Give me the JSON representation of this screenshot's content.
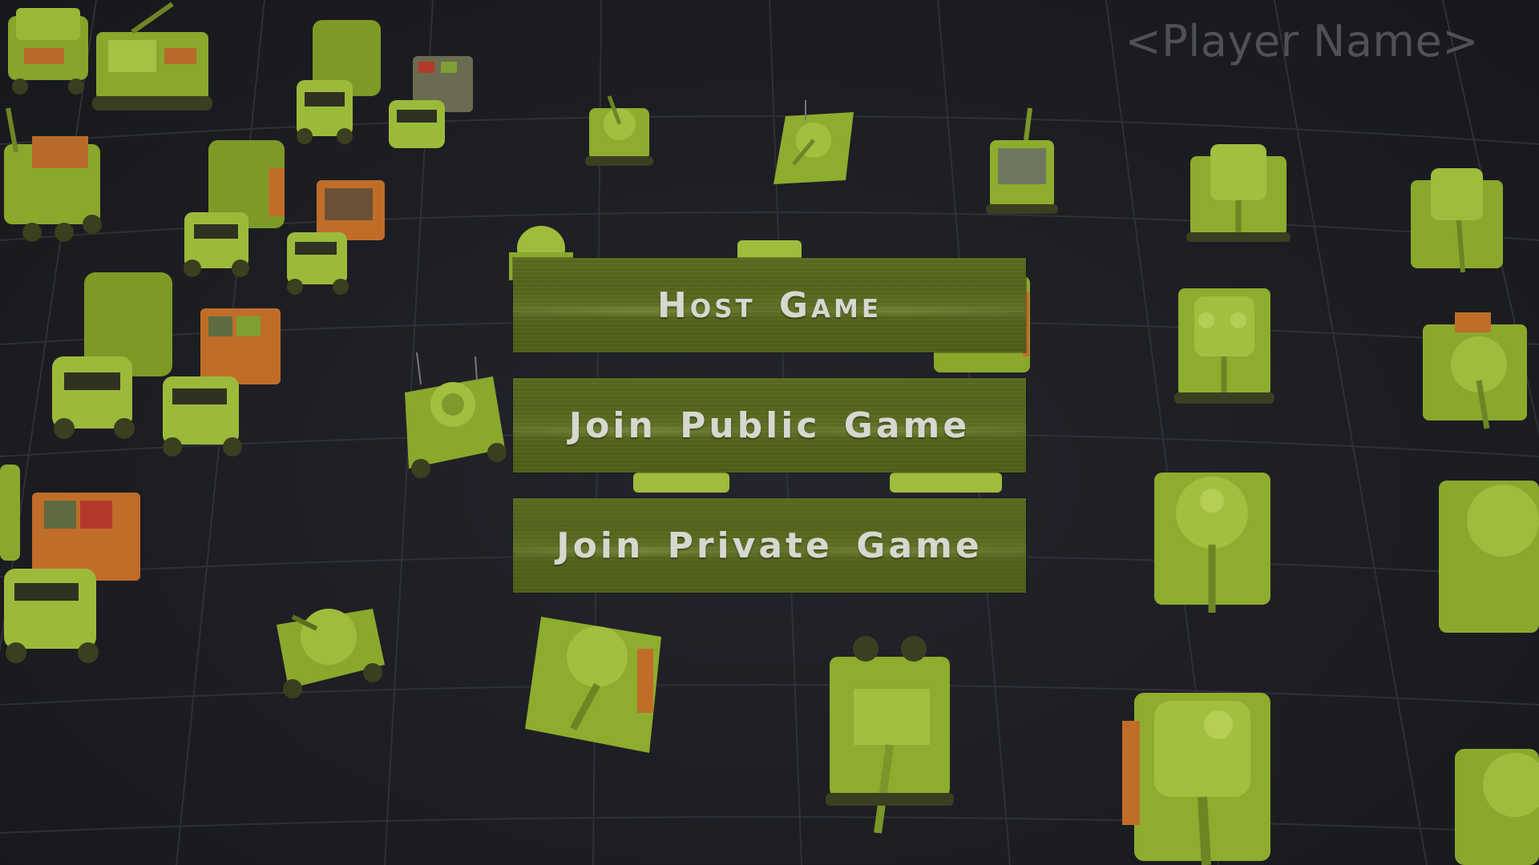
{
  "header": {
    "player_name_placeholder": "<Player Name>"
  },
  "menu": {
    "buttons": [
      {
        "id": "host",
        "label": "Host Game"
      },
      {
        "id": "join_public",
        "label": "Join Public Game"
      },
      {
        "id": "join_private",
        "label": "Join Private Game"
      }
    ]
  },
  "colors": {
    "button_bg": "#55651c",
    "button_text": "#d6d8cf",
    "background": "#1d1e24",
    "vehicle_green": "#8fae2e",
    "placeholder_text": "#4f5157"
  }
}
